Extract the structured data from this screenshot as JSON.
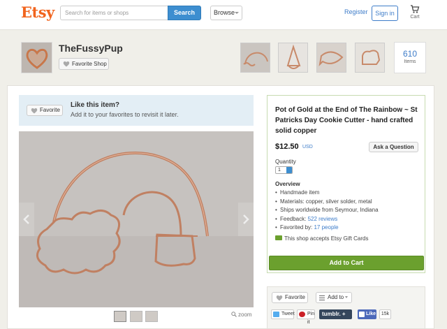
{
  "header": {
    "logo": "Etsy",
    "search_placeholder": "Search for items or shops",
    "search_button": "Search",
    "browse_label": "Browse",
    "register_label": "Register",
    "signin_label": "Sign in",
    "cart_label": "Cart"
  },
  "shop": {
    "name": "TheFussyPup",
    "favorite_shop_label": "Favorite Shop",
    "items_count": "610",
    "items_label": "Items"
  },
  "like_box": {
    "favorite_label": "Favorite",
    "title": "Like this item?",
    "subtitle": "Add it to your favorites to revisit it later."
  },
  "gallery": {
    "zoom_label": "zoom"
  },
  "listing": {
    "title": "Pot of Gold at the End of The Rainbow ~ St Patricks Day Cookie Cutter - hand crafted solid copper",
    "price": "$12.50",
    "currency": "USD",
    "ask_question": "Ask a Question",
    "quantity_label": "Quantity",
    "quantity_value": "1",
    "overview_title": "Overview",
    "overview": {
      "item_type": "Handmade item",
      "materials": "Materials: copper, silver solder, metal",
      "ships": "Ships worldwide from Seymour, Indiana",
      "feedback_prefix": "Feedback: ",
      "feedback_link": "522 reviews",
      "favorited_prefix": "Favorited by: ",
      "favorited_link": "17 people"
    },
    "gift_cards": "This shop accepts Etsy Gift Cards",
    "add_to_cart": "Add to Cart"
  },
  "social": {
    "favorite_label": "Favorite",
    "add_to_label": "Add to",
    "tweet_label": "Tweet",
    "pinit_label": "Pin it",
    "tumblr_label": "tumblr. +",
    "fb_like_label": "Like",
    "fb_count": "15k"
  },
  "colors": {
    "brand": "#f1641e",
    "link": "#3d7cc9",
    "cart_green": "#6ba02e",
    "tumblr": "#35465c",
    "facebook": "#4c69ba"
  }
}
